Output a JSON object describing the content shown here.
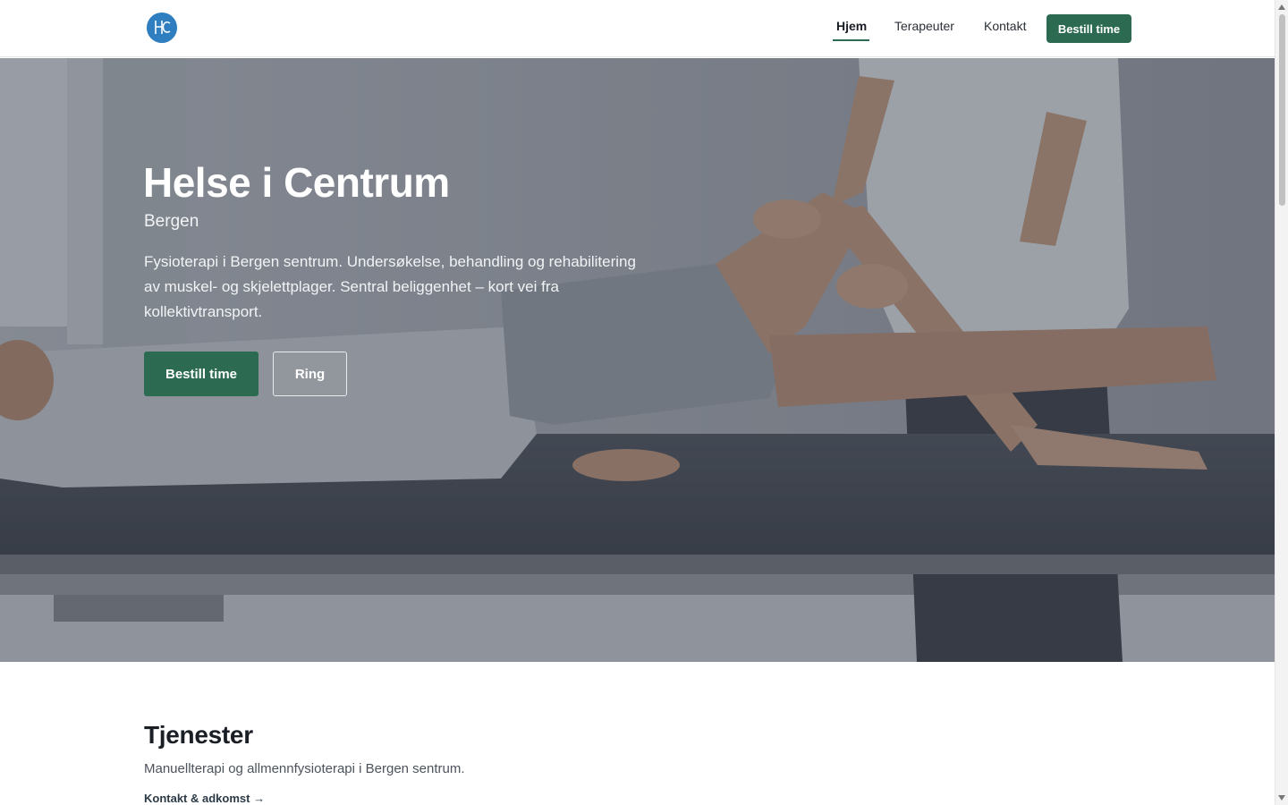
{
  "header": {
    "logo_icon": "hc-logo-icon",
    "nav": [
      {
        "label": "Hjem",
        "active": true
      },
      {
        "label": "Terapeuter",
        "active": false
      },
      {
        "label": "Kontakt",
        "active": false
      }
    ],
    "cta_label": "Bestill time"
  },
  "hero": {
    "title": "Helse i Centrum",
    "subtitle": "Bergen",
    "description": "Fysioterapi i Bergen sentrum. Undersøkelse, behandling og rehabilitering av muskel- og skjelettplager. Sentral beliggenhet – kort vei fra kollektivtransport.",
    "primary_button": "Bestill time",
    "secondary_button": "Ring",
    "image_alt": "physiotherapist-treating-patient-knee-photo"
  },
  "services": {
    "title": "Tjenester",
    "description": "Manuellterapi og allmennfysioterapi i Bergen sentrum.",
    "link": "Kontakt & adkomst →"
  },
  "colors": {
    "accent": "#2c6b52",
    "logo": "#2f7fc0"
  }
}
